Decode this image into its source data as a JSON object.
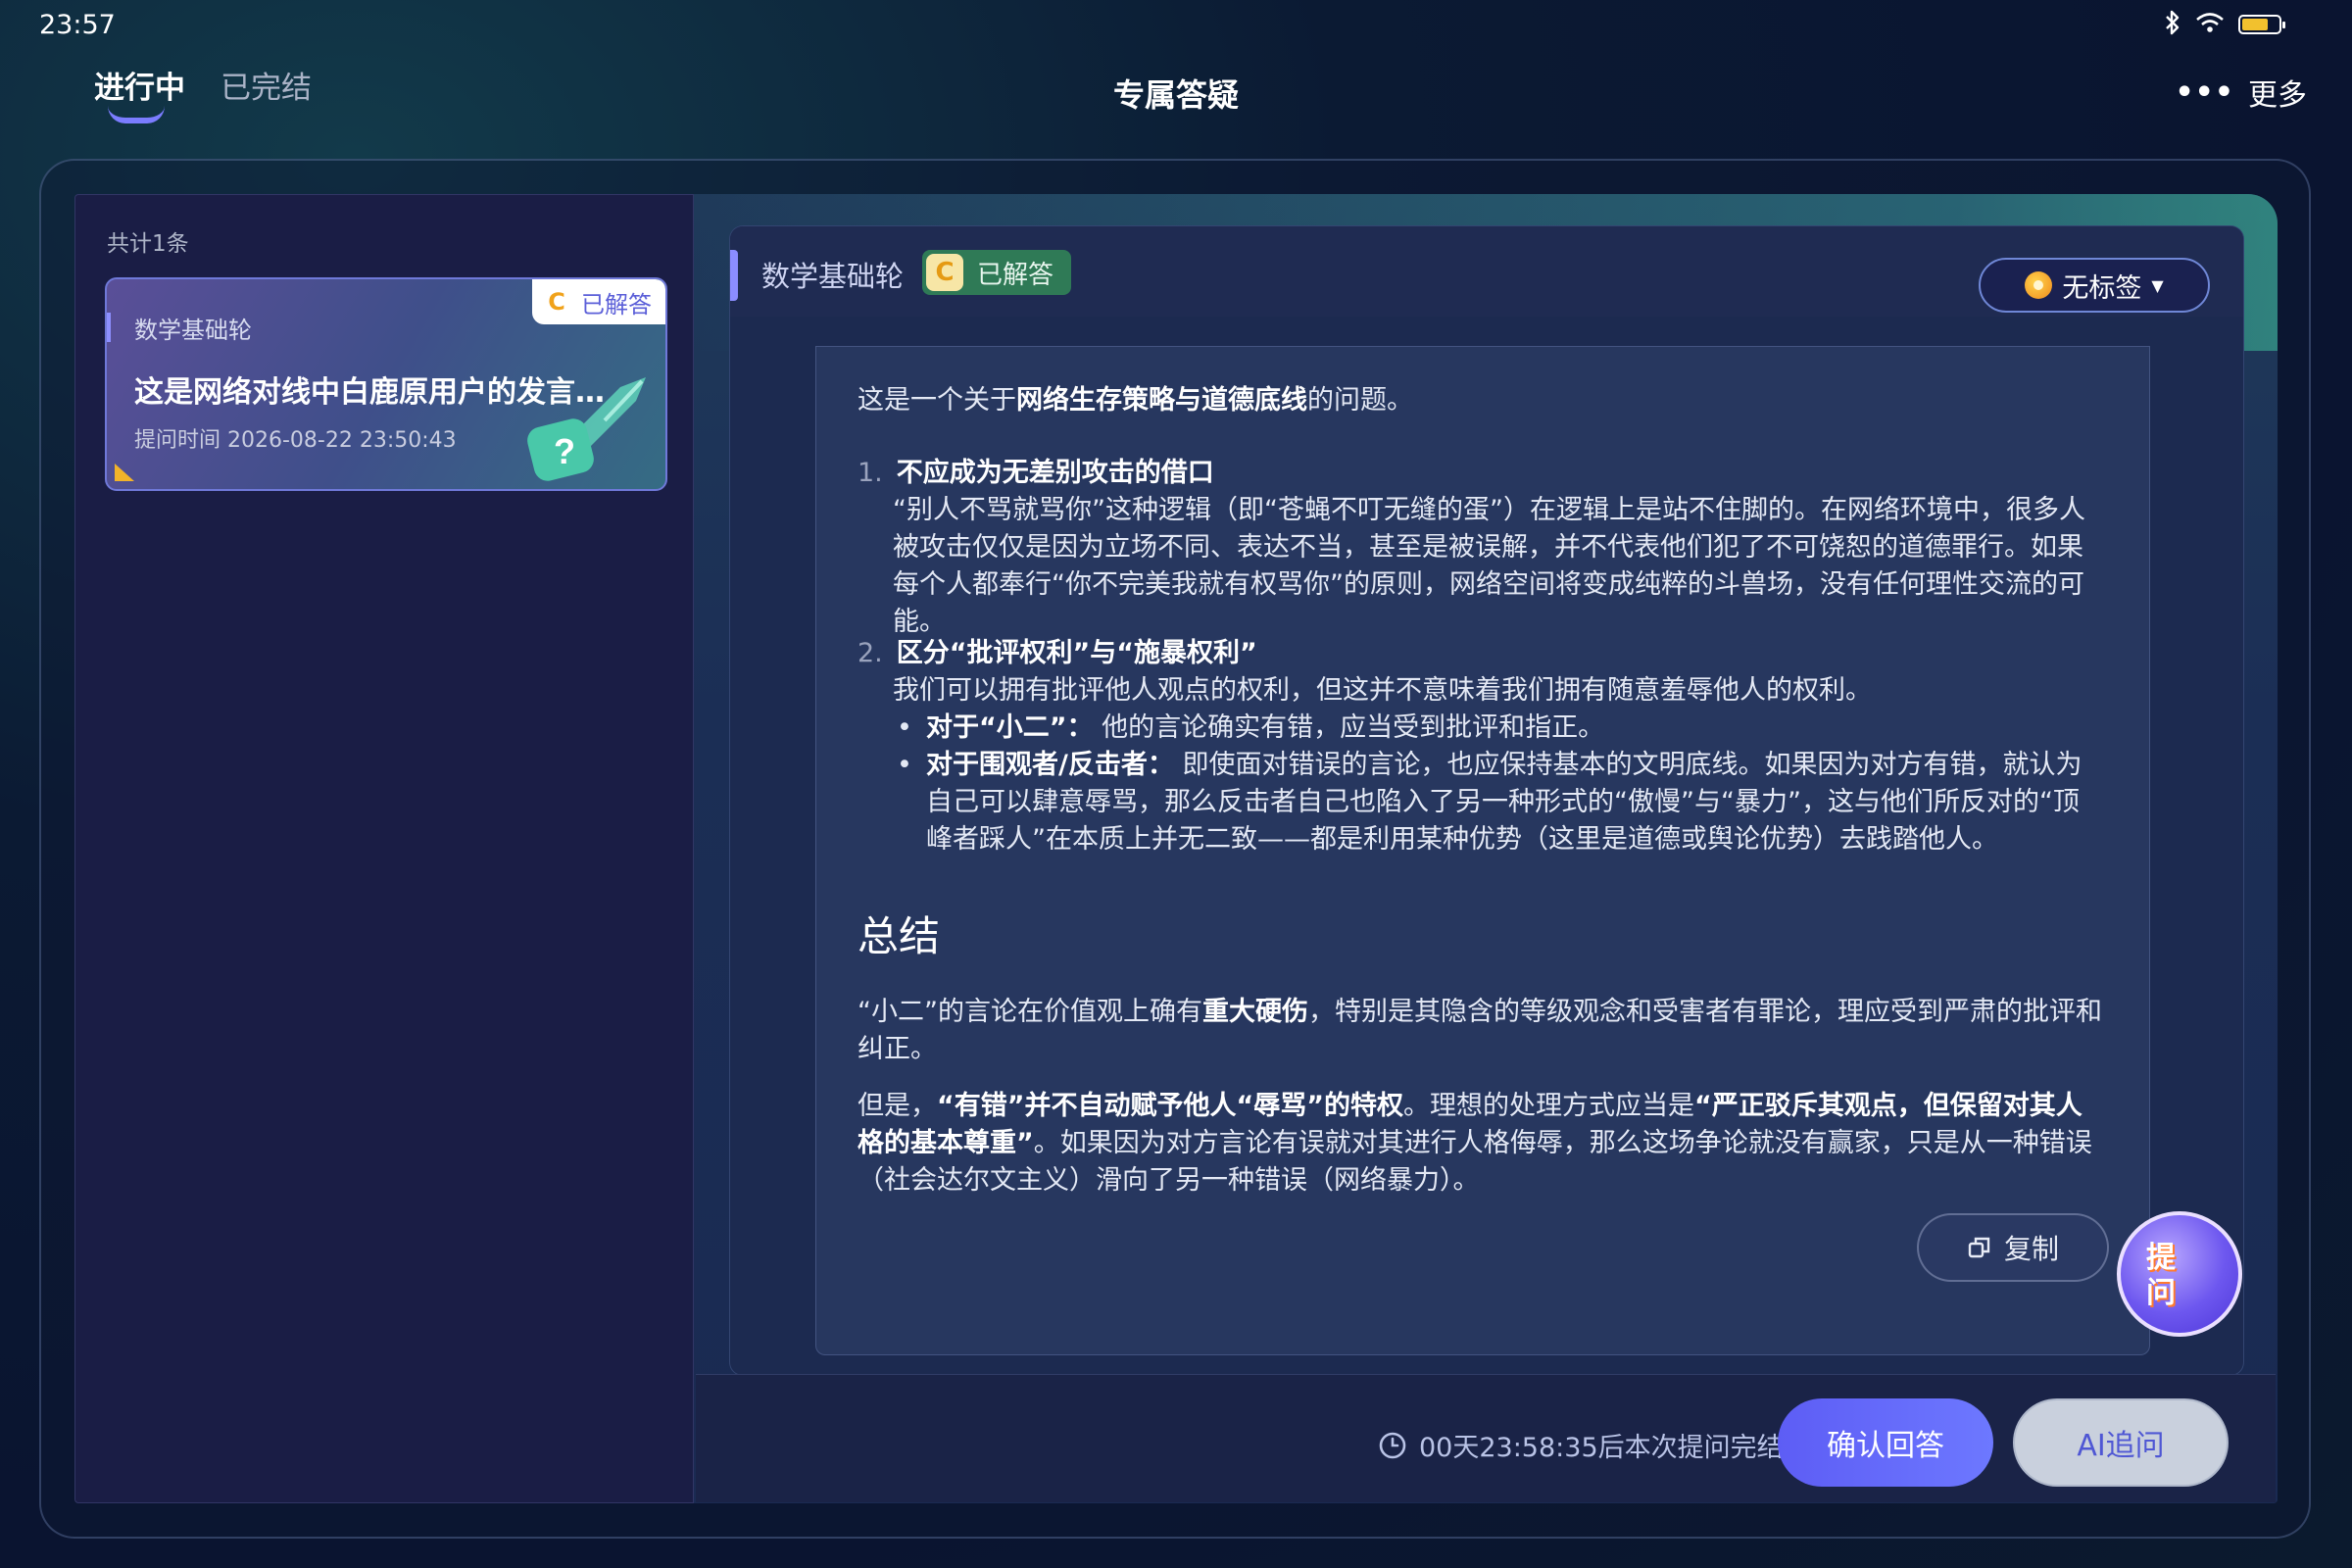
{
  "status_bar": {
    "time": "23:57"
  },
  "header": {
    "tabs": [
      {
        "label": "进行中",
        "active": true
      },
      {
        "label": "已完结",
        "active": false
      }
    ],
    "title": "专属答疑",
    "more_label": "更多"
  },
  "sidebar": {
    "count_label": "共计1条",
    "card": {
      "subject": "数学基础轮",
      "badge_letter": "C",
      "badge_status": "已解答",
      "title": "这是网络对线中白鹿原用户的发言，…",
      "time": "提问时间 2026-08-22 23:50:43"
    }
  },
  "detail": {
    "subject": "数学基础轮",
    "badge_letter": "C",
    "badge_status": "已解答",
    "tag_label": "无标签",
    "answer": {
      "intro_pre": "这是一个关于",
      "intro_bold": "网络生存策略与道德底线",
      "intro_post": "的问题。",
      "item1_num": "1.",
      "item1_title": "不应成为无差别攻击的借口",
      "item1_body": "“别人不骂就骂你”这种逻辑（即“苍蝇不叮无缝的蛋”）在逻辑上是站不住脚的。在网络环境中，很多人被攻击仅仅是因为立场不同、表达不当，甚至是被误解，并不代表他们犯了不可饶恕的道德罪行。如果每个人都奉行“你不完美我就有权骂你”的原则，网络空间将变成纯粹的斗兽场，没有任何理性交流的可能。",
      "item2_num": "2.",
      "item2_title": "区分“批评权利”与“施暴权利”",
      "item2_body": "我们可以拥有批评他人观点的权利，但这并不意味着我们拥有随意羞辱他人的权利。",
      "bullet1_bold": "对于“小二”：",
      "bullet1_text": " 他的言论确实有错，应当受到批评和指正。",
      "bullet2_bold": "对于围观者/反击者：",
      "bullet2_text": " 即使面对错误的言论，也应保持基本的文明底线。如果因为对方有错，就认为自己可以肆意辱骂，那么反击者自己也陷入了另一种形式的“傲慢”与“暴力”，这与他们所反对的“顶峰者踩人”在本质上并无二致——都是利用某种优势（这里是道德或舆论优势）去践踏他人。",
      "summary_heading": "总结",
      "p1_pre": "“小二”的言论在价值观上确有",
      "p1_bold": "重大硬伤",
      "p1_post": "，特别是其隐含的等级观念和受害者有罪论，理应受到严肃的批评和纠正。",
      "p2_pre": "但是，",
      "p2_bold1": "“有错”并不自动赋予他人“辱骂”的特权",
      "p2_mid": "。理想的处理方式应当是",
      "p2_bold2": "“严正驳斥其观点，但保留对其人格的基本尊重”",
      "p2_post": "。如果因为对方言论有误就对其进行人格侮辱，那么这场争论就没有赢家，只是从一种错误（社会达尔文主义）滑向了另一种错误（网络暴力）。"
    },
    "copy_label": "复制",
    "ask_fab_label": "提问"
  },
  "footer": {
    "countdown": "00天23:58:35后本次提问完结",
    "confirm_label": "确认回答",
    "ai_label": "AI追问"
  },
  "colors": {
    "accent": "#6d6cff",
    "badge_green": "#2f7a56",
    "badge_orange": "#f0a21b"
  }
}
